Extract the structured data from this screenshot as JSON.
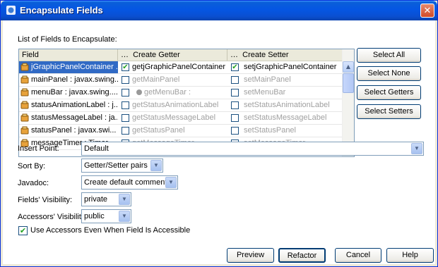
{
  "window": {
    "title": "Encapsulate Fields",
    "close": "✕"
  },
  "list_label": "List of Fields to Encapsulate:",
  "table": {
    "headers": {
      "field": "Field",
      "getter": "Create Getter",
      "setter": "Create Setter",
      "ellipsis": "…"
    },
    "rows": [
      {
        "field": "jGraphicPanelContainer ...",
        "getter": "getjGraphicPanelContainer",
        "setter": "setjGraphicPanelContainer",
        "getter_checked": true,
        "setter_checked": true,
        "getter_enabled": true,
        "setter_enabled": true
      },
      {
        "field": "mainPanel : javax.swing....",
        "getter": "getMainPanel",
        "setter": "setMainPanel",
        "getter_checked": false,
        "setter_checked": false,
        "getter_enabled": false,
        "setter_enabled": false
      },
      {
        "field": "menuBar : javax.swing....",
        "getter": "getMenuBar :",
        "setter": "setMenuBar",
        "getter_checked": false,
        "setter_checked": false,
        "getter_enabled": false,
        "setter_enabled": false
      },
      {
        "field": "statusAnimationLabel : j...",
        "getter": "getStatusAnimationLabel",
        "setter": "setStatusAnimationLabel",
        "getter_checked": false,
        "setter_checked": false,
        "getter_enabled": false,
        "setter_enabled": false
      },
      {
        "field": "statusMessageLabel : ja...",
        "getter": "getStatusMessageLabel",
        "setter": "setStatusMessageLabel",
        "getter_checked": false,
        "setter_checked": false,
        "getter_enabled": false,
        "setter_enabled": false
      },
      {
        "field": "statusPanel : javax.swi...",
        "getter": "getStatusPanel",
        "setter": "setStatusPanel",
        "getter_checked": false,
        "setter_checked": false,
        "getter_enabled": false,
        "setter_enabled": false
      },
      {
        "field": "messageTimer : Timer",
        "getter": "getMessageTimer",
        "setter": "setMessageTimer",
        "getter_checked": false,
        "setter_checked": false,
        "getter_enabled": false,
        "setter_enabled": false
      }
    ]
  },
  "side_buttons": {
    "select_all": "Select All",
    "select_none": "Select None",
    "select_getters": "Select Getters",
    "select_setters": "Select Setters"
  },
  "insert_point": {
    "label": "Insert Point:",
    "value": "Default"
  },
  "sort_by": {
    "label": "Sort By:",
    "value": "Getter/Setter pairs"
  },
  "javadoc": {
    "label": "Javadoc:",
    "value": "Create default comments"
  },
  "fields_visibility": {
    "label": "Fields' Visibility:",
    "value": "private"
  },
  "accessors_visibility": {
    "label": "Accessors' Visibility:",
    "value": "public"
  },
  "use_accessors": {
    "label": "Use Accessors Even When Field Is Accessible",
    "checked": true
  },
  "footer": {
    "preview": "Preview",
    "refactor": "Refactor",
    "cancel": "Cancel",
    "help": "Help"
  },
  "icons": {
    "check": "✔",
    "arrow_down": "▼",
    "arrow_up": "▲"
  }
}
